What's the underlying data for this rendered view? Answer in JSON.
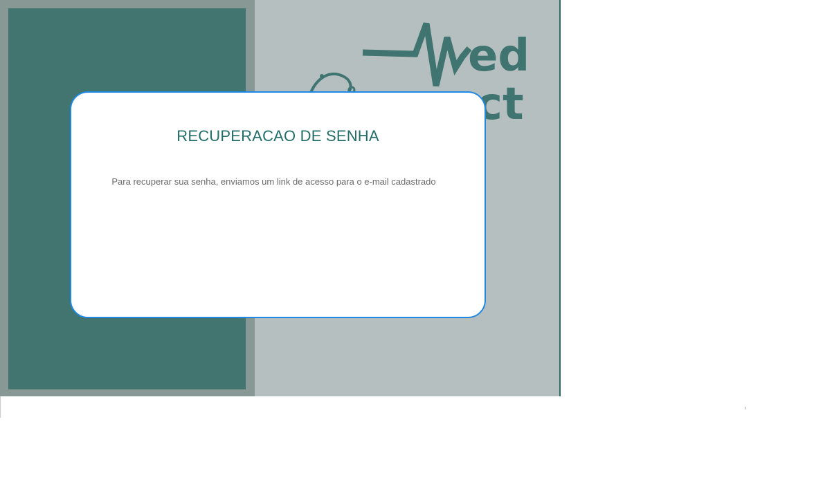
{
  "logo": {
    "text_top": "ed",
    "text_bottom": "ct",
    "brand_color": "#3f7470"
  },
  "colors": {
    "background_panel": "#b6bfbf",
    "left_frame": "#879895",
    "left_inner": "#42756f",
    "modal_border": "#1e88e5",
    "title_color": "#216e69",
    "text_color": "#6a6a6a"
  },
  "modal": {
    "title": "RECUPERACAO DE SENHA",
    "message": "Para recuperar sua senha, enviamos um link de acesso para o e-mail cadastrado"
  }
}
